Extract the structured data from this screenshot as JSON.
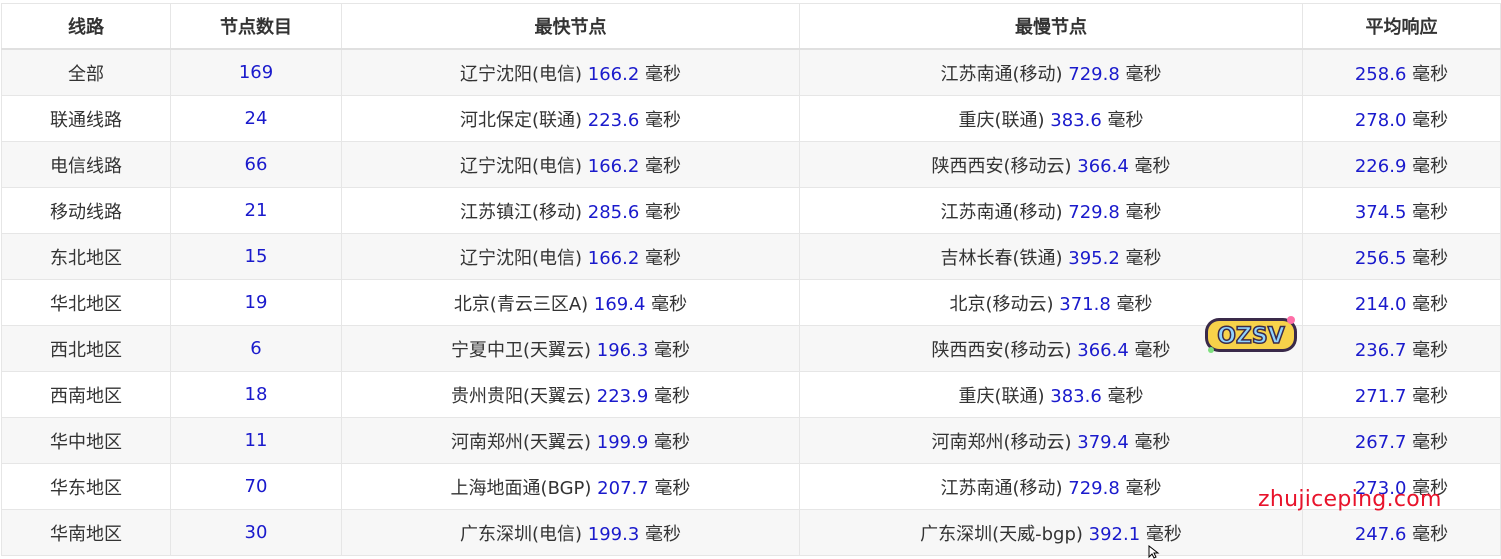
{
  "table": {
    "headers": [
      "线路",
      "节点数目",
      "最快节点",
      "最慢节点",
      "平均响应"
    ],
    "unit": "毫秒",
    "rows": [
      {
        "line": "全部",
        "count": "169",
        "fast_name": "辽宁沈阳(电信)",
        "fast_ms": "166.2",
        "slow_name": "江苏南通(移动)",
        "slow_ms": "729.8",
        "avg_ms": "258.6"
      },
      {
        "line": "联通线路",
        "count": "24",
        "fast_name": "河北保定(联通)",
        "fast_ms": "223.6",
        "slow_name": "重庆(联通)",
        "slow_ms": "383.6",
        "avg_ms": "278.0"
      },
      {
        "line": "电信线路",
        "count": "66",
        "fast_name": "辽宁沈阳(电信)",
        "fast_ms": "166.2",
        "slow_name": "陕西西安(移动云)",
        "slow_ms": "366.4",
        "avg_ms": "226.9"
      },
      {
        "line": "移动线路",
        "count": "21",
        "fast_name": "江苏镇江(移动)",
        "fast_ms": "285.6",
        "slow_name": "江苏南通(移动)",
        "slow_ms": "729.8",
        "avg_ms": "374.5"
      },
      {
        "line": "东北地区",
        "count": "15",
        "fast_name": "辽宁沈阳(电信)",
        "fast_ms": "166.2",
        "slow_name": "吉林长春(铁通)",
        "slow_ms": "395.2",
        "avg_ms": "256.5"
      },
      {
        "line": "华北地区",
        "count": "19",
        "fast_name": "北京(青云三区A)",
        "fast_ms": "169.4",
        "slow_name": "北京(移动云)",
        "slow_ms": "371.8",
        "avg_ms": "214.0"
      },
      {
        "line": "西北地区",
        "count": "6",
        "fast_name": "宁夏中卫(天翼云)",
        "fast_ms": "196.3",
        "slow_name": "陕西西安(移动云)",
        "slow_ms": "366.4",
        "avg_ms": "236.7"
      },
      {
        "line": "西南地区",
        "count": "18",
        "fast_name": "贵州贵阳(天翼云)",
        "fast_ms": "223.9",
        "slow_name": "重庆(联通)",
        "slow_ms": "383.6",
        "avg_ms": "271.7"
      },
      {
        "line": "华中地区",
        "count": "11",
        "fast_name": "河南郑州(天翼云)",
        "fast_ms": "199.9",
        "slow_name": "河南郑州(移动云)",
        "slow_ms": "379.4",
        "avg_ms": "267.7"
      },
      {
        "line": "华东地区",
        "count": "70",
        "fast_name": "上海地面通(BGP)",
        "fast_ms": "207.7",
        "slow_name": "江苏南通(移动)",
        "slow_ms": "729.8",
        "avg_ms": "273.0"
      },
      {
        "line": "华南地区",
        "count": "30",
        "fast_name": "广东深圳(电信)",
        "fast_ms": "199.3",
        "slow_name": "广东深圳(天威-bgp)",
        "slow_ms": "392.1",
        "avg_ms": "247.6"
      }
    ]
  },
  "overlay": {
    "watermark": "zhujiceping.com",
    "logo_text": "OZSV"
  },
  "colors": {
    "number": "#1a1acc",
    "watermark": "#e8132b",
    "row_stripe": "#f7f7f7"
  }
}
